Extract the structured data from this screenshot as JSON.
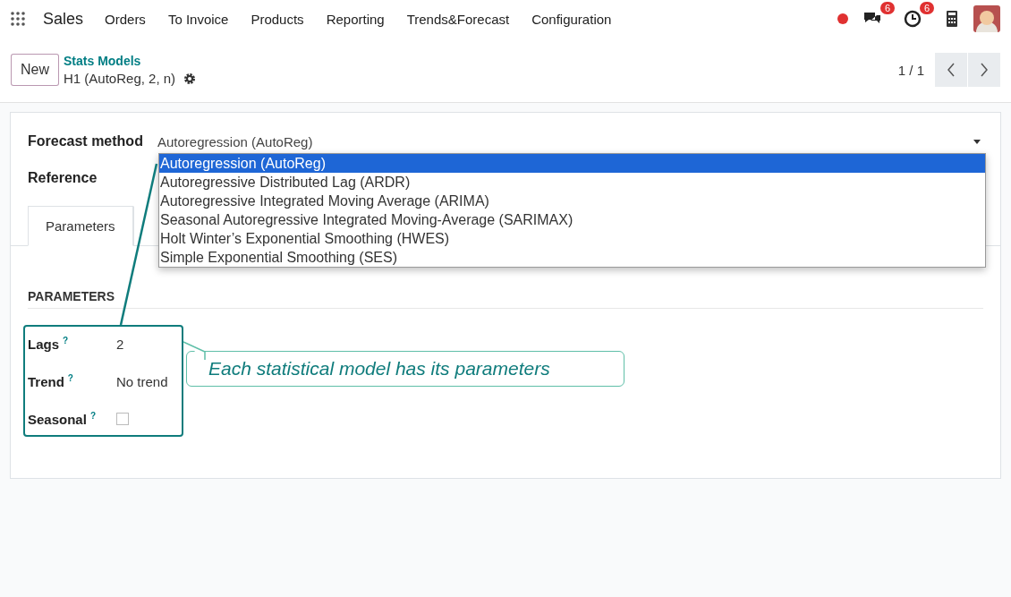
{
  "navbar": {
    "app_name": "Sales",
    "menu": [
      "Orders",
      "To Invoice",
      "Products",
      "Reporting",
      "Trends&Forecast",
      "Configuration"
    ],
    "messages_badge": "6",
    "activities_badge": "6"
  },
  "control_panel": {
    "new_button": "New",
    "breadcrumb": "Stats Models",
    "record_title": "H1 (AutoReg, 2, n)",
    "pager": "1 / 1"
  },
  "form": {
    "forecast_method_label": "Forecast method",
    "forecast_method_value": "Autoregression (AutoReg)",
    "reference_label": "Reference",
    "tabs": [
      {
        "label": "Parameters",
        "selected": true
      }
    ],
    "section_title": "PARAMETERS",
    "fields": [
      {
        "kind": "text",
        "label": "Lags",
        "help": "?",
        "value": "2"
      },
      {
        "kind": "text",
        "label": "Trend",
        "help": "?",
        "value": "No trend"
      },
      {
        "kind": "checkbox",
        "label": "Seasonal",
        "help": "?",
        "checked": false
      }
    ]
  },
  "dropdown": {
    "options": [
      {
        "label": "Autoregression (AutoReg)",
        "selected": true
      },
      {
        "label": "Autoregressive Distributed Lag (ARDR)",
        "selected": false
      },
      {
        "label": "Autoregressive Integrated Moving Average (ARIMA)",
        "selected": false
      },
      {
        "label": "Seasonal Autoregressive Integrated Moving-Average (SARIMAX)",
        "selected": false
      },
      {
        "label": "Holt Winter’s Exponential Smoothing (HWES)",
        "selected": false
      },
      {
        "label": "Simple Exponential Smoothing (SES)",
        "selected": false
      }
    ]
  },
  "annotation": {
    "text": "Each statistical model has its parameters"
  }
}
